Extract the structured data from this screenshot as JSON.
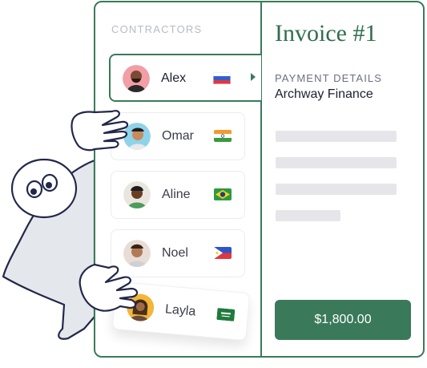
{
  "sidebar": {
    "section_label": "CONTRACTORS",
    "contractors": [
      {
        "name": "Alex",
        "flag": "Russia",
        "active": true
      },
      {
        "name": "Omar",
        "flag": "India",
        "active": false
      },
      {
        "name": "Aline",
        "flag": "Brazil",
        "active": false
      },
      {
        "name": "Noel",
        "flag": "Philippines",
        "active": false
      },
      {
        "name": "Layla",
        "flag": "Saudi Arabia",
        "active": false
      }
    ]
  },
  "invoice": {
    "title": "Invoice #1",
    "payment_label": "PAYMENT DETAILS",
    "payment_value": "Archway Finance",
    "amount_button": "$1,800.00"
  },
  "colors": {
    "accent": "#3a7a5a",
    "skeleton": "#e6e6ea"
  }
}
